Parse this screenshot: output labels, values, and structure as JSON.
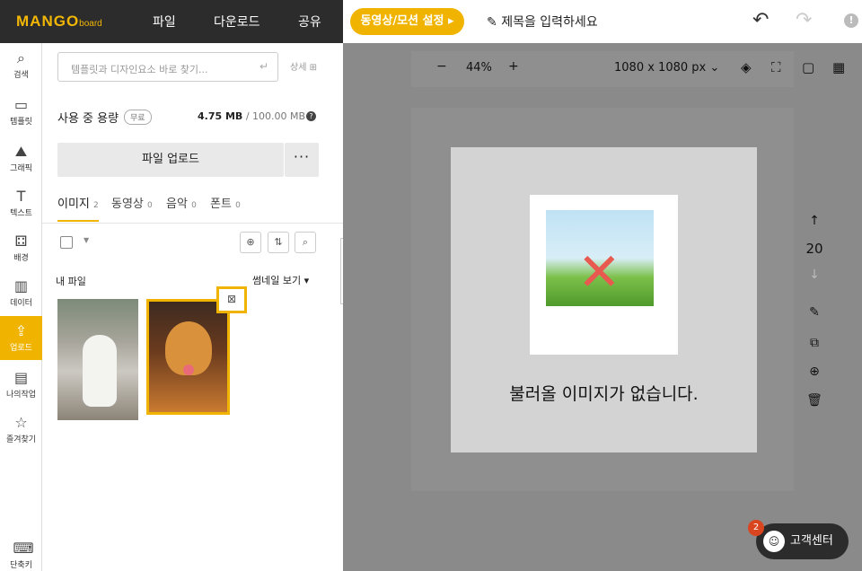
{
  "app": {
    "logo": "MANGO",
    "logo_sub": "board",
    "nav": [
      "파일",
      "다운로드",
      "공유"
    ],
    "video_btn": "동영상/모션 설정 ▸",
    "title_placeholder": "제목을 입력하세요"
  },
  "sidebar": {
    "items": [
      {
        "label": "검색",
        "icon": "search-icon"
      },
      {
        "label": "템플릿",
        "icon": "template-icon"
      },
      {
        "label": "그래픽",
        "icon": "graphic-icon"
      },
      {
        "label": "텍스트",
        "icon": "text-icon"
      },
      {
        "label": "배경",
        "icon": "background-icon"
      },
      {
        "label": "데이터",
        "icon": "data-icon"
      },
      {
        "label": "업로드",
        "icon": "upload-icon"
      },
      {
        "label": "나의작업",
        "icon": "my-work-icon"
      },
      {
        "label": "즐겨찾기",
        "icon": "star-icon"
      },
      {
        "label": "단축키",
        "icon": "keyboard-icon"
      }
    ]
  },
  "panel": {
    "search_placeholder": "템플릿과 디자인요소 바로 찾기...",
    "detail": "상세",
    "usage_label": "사용 중 용량",
    "free_badge": "무료",
    "usage_used": "4.75 MB",
    "usage_total": "/ 100.00 MB",
    "upload_btn": "파일 업로드",
    "more": "···",
    "tabs": [
      {
        "label": "이미지",
        "count": "2"
      },
      {
        "label": "동영상",
        "count": "0"
      },
      {
        "label": "음악",
        "count": "0"
      },
      {
        "label": "폰트",
        "count": "0"
      }
    ],
    "my_file": "내 파일",
    "thumb_view": "썸네일 보기 ▾"
  },
  "canvas": {
    "zoom": "44%",
    "size": "1080 x 1080 px",
    "page_number": "20",
    "error_text": "불러올 이미지가 없습니다."
  },
  "help": {
    "label": "고객센터",
    "badge": "2"
  },
  "colors": {
    "accent": "#f0b400",
    "topbar": "#2c2c2c",
    "error_x": "#e85a4f"
  }
}
